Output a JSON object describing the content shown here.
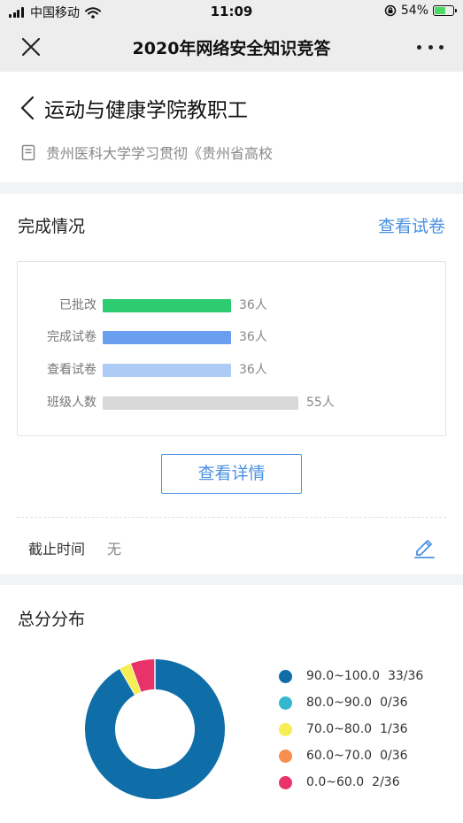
{
  "status_bar": {
    "carrier": "中国移动",
    "time": "11:09",
    "battery": "54%"
  },
  "nav": {
    "title": "2020年网络安全知识竞答"
  },
  "header": {
    "class_name": "运动与健康学院教职工",
    "task_title": "贵州医科大学学习贯彻《贵州省高校"
  },
  "completion": {
    "title": "完成情况",
    "view_paper_link": "查看试卷",
    "bars": [
      {
        "label": "已批改",
        "count": 36,
        "value_text": "36人",
        "color": "#2ecc71"
      },
      {
        "label": "完成试卷",
        "count": 36,
        "value_text": "36人",
        "color": "#6a9ff0"
      },
      {
        "label": "查看试卷",
        "count": 36,
        "value_text": "36人",
        "color": "#aecbf5"
      },
      {
        "label": "班级人数",
        "count": 55,
        "value_text": "55人",
        "color": "#d8d8d8"
      }
    ],
    "detail_button": "查看详情",
    "deadline_label": "截止时间",
    "deadline_value": "无"
  },
  "distribution": {
    "title": "总分分布",
    "legend": [
      {
        "range": "90.0~100.0",
        "count_text": "33/36",
        "count": 33,
        "color": "#0f6ea8"
      },
      {
        "range": "80.0~90.0",
        "count_text": "0/36",
        "count": 0,
        "color": "#35b7cf"
      },
      {
        "range": "70.0~80.0",
        "count_text": "1/36",
        "count": 1,
        "color": "#f5ef55"
      },
      {
        "range": "60.0~70.0",
        "count_text": "0/36",
        "count": 0,
        "color": "#f58e4f"
      },
      {
        "range": "0.0~60.0",
        "count_text": "2/36",
        "count": 2,
        "color": "#e8336a"
      }
    ],
    "total": 36
  }
}
